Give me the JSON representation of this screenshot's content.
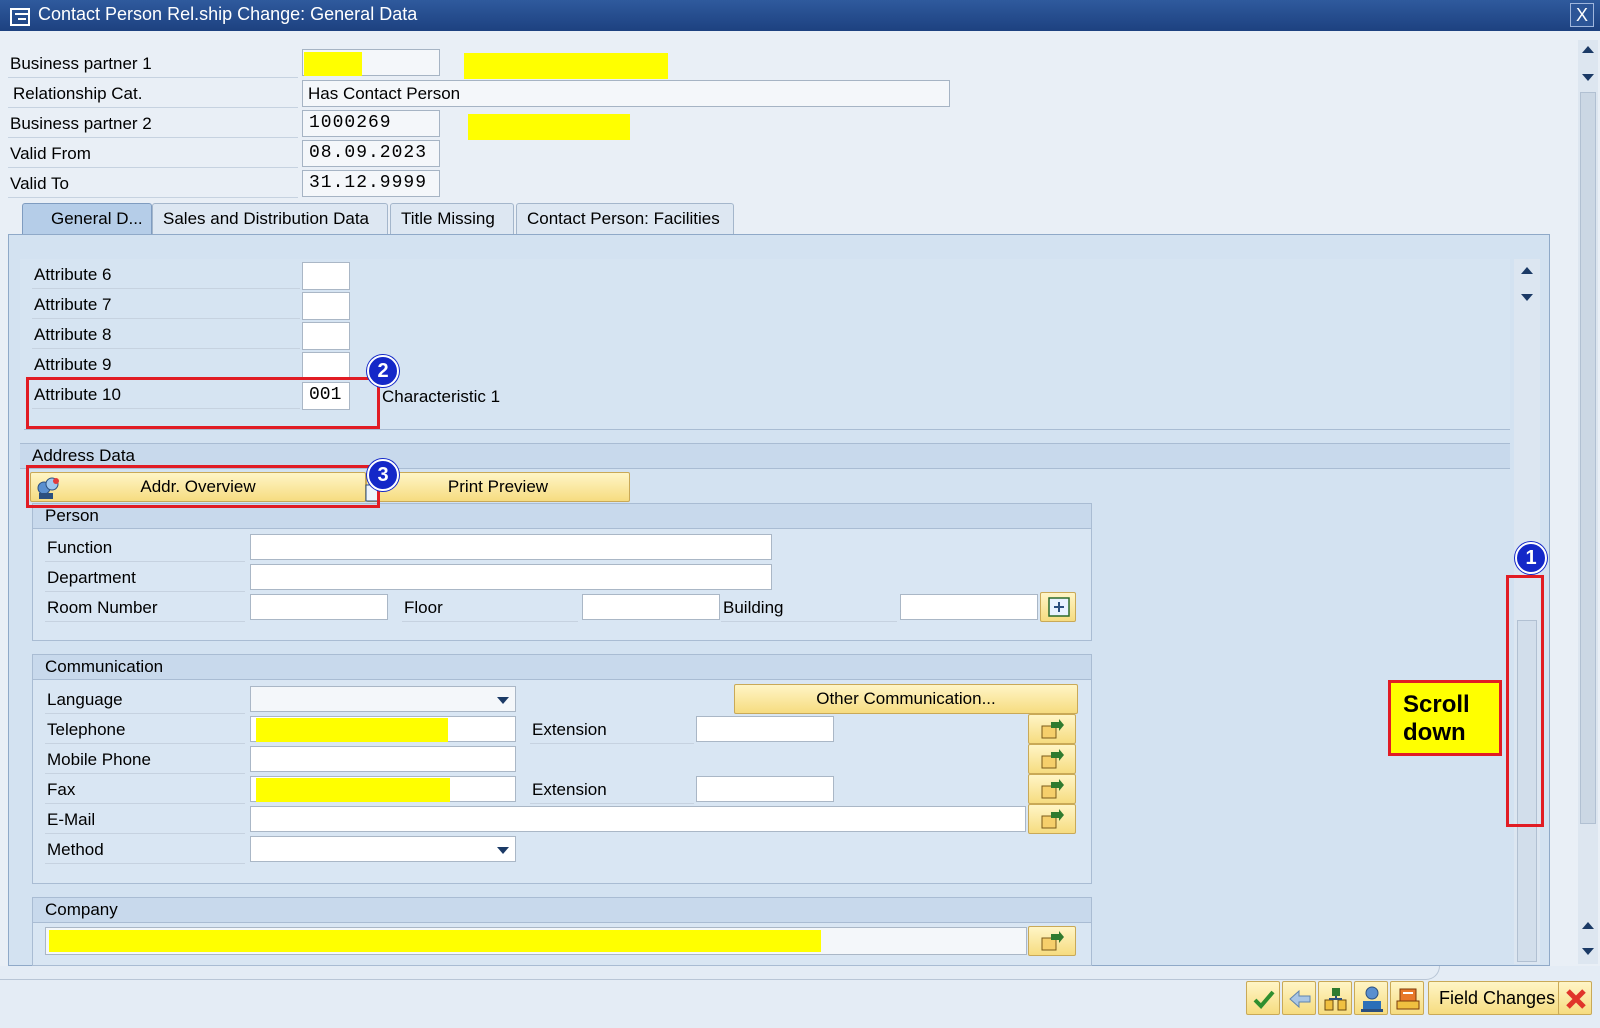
{
  "window": {
    "title": "Contact Person Rel.ship Change: General Data",
    "close_label": "X"
  },
  "header_fields": {
    "bp1_label": "Business partner 1",
    "relcat_label": "Relationship Cat.",
    "relcat_value": "Has Contact Person",
    "bp2_label": "Business partner 2",
    "bp2_value": "1000269",
    "valid_from_label": "Valid From",
    "valid_from_value": "08.09.2023",
    "valid_to_label": "Valid To",
    "valid_to_value": "31.12.9999"
  },
  "tabs": [
    {
      "label": "General D...",
      "active": true
    },
    {
      "label": "Sales and Distribution Data",
      "active": false
    },
    {
      "label": "Title Missing",
      "active": false
    },
    {
      "label": "Contact Person: Facilities",
      "active": false
    }
  ],
  "attributes": {
    "attr6": "Attribute 6",
    "attr7": "Attribute 7",
    "attr8": "Attribute 8",
    "attr9": "Attribute 9",
    "attr10": "Attribute 10",
    "attr10_value": "001",
    "attr10_desc": "Characteristic 1"
  },
  "address": {
    "section_title": "Address Data",
    "addr_overview_label": "Addr. Overview",
    "print_preview_label": "Print Preview",
    "person_title": "Person",
    "function_label": "Function",
    "department_label": "Department",
    "room_label": "Room Number",
    "floor_label": "Floor",
    "building_label": "Building",
    "comm_title": "Communication",
    "language_label": "Language",
    "other_comm_label": "Other Communication...",
    "telephone_label": "Telephone",
    "extension_label": "Extension",
    "mobile_label": "Mobile Phone",
    "fax_label": "Fax",
    "fax_extension_label": "Extension",
    "email_label": "E-Mail",
    "method_label": "Method",
    "company_title": "Company"
  },
  "annotations": {
    "badge1": "1",
    "badge2": "2",
    "badge3": "3",
    "scroll_note_line1": "Scroll",
    "scroll_note_line2": "down"
  },
  "footer": {
    "field_changes_label": "Field Changes"
  },
  "colors": {
    "title_bar": "#1d4180",
    "redaction": "#ffff00",
    "annotation_red": "#e11c24",
    "badge_blue": "#1428c8"
  }
}
